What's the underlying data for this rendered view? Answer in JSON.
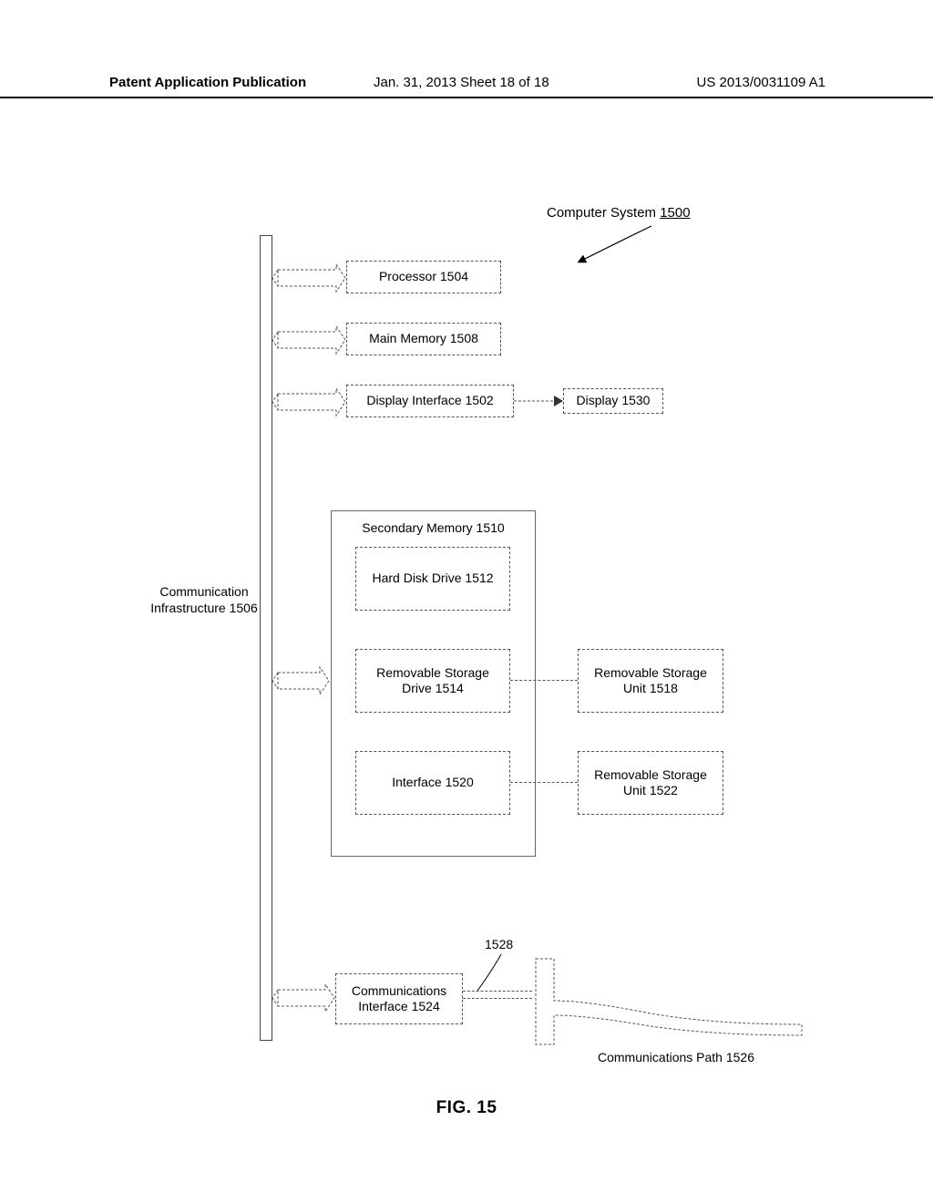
{
  "header": {
    "left": "Patent Application Publication",
    "center": "Jan. 31, 2013  Sheet 18 of 18",
    "right": "US 2013/0031109 A1"
  },
  "system_label": {
    "text": "Computer System",
    "num": "1500"
  },
  "bus": {
    "label": "Communication Infrastructure 1506"
  },
  "boxes": {
    "processor": "Processor 1504",
    "main_memory": "Main Memory 1508",
    "display_interface": "Display Interface 1502",
    "display": "Display 1530",
    "secondary_memory_label": "Secondary Memory 1510",
    "hard_disk": "Hard Disk Drive 1512",
    "removable_drive": "Removable Storage Drive 1514",
    "interface_1520": "Interface 1520",
    "removable_unit_1518": "Removable Storage Unit 1518",
    "removable_unit_1522": "Removable Storage Unit 1522",
    "comm_interface": "Communications Interface 1524"
  },
  "leaders": {
    "ref_1528": "1528"
  },
  "comm_path": "Communications Path 1526",
  "figure_caption": "FIG. 15"
}
